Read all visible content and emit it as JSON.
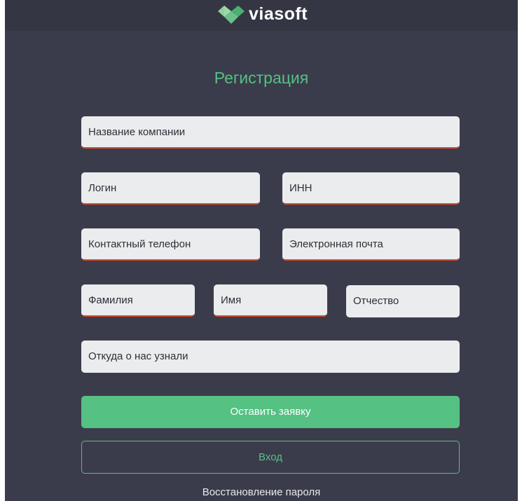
{
  "header": {
    "brand_name": "viasoft",
    "logo_icon": "viasoft-diamond-logo-icon",
    "colors": {
      "light_green": "#8fd19e",
      "dark_green": "#4caf70"
    }
  },
  "form": {
    "title": "Регистрация",
    "fields": {
      "company_name": "Название компании",
      "login": "Логин",
      "inn": "ИНН",
      "phone": "Контактный телефон",
      "email": "Электронная почта",
      "last_name": "Фамилия",
      "first_name": "Имя",
      "middle_name": "Отчество",
      "referral_source": "Откуда о нас узнали"
    },
    "submit_label": "Оставить заявку",
    "login_label": "Вход",
    "recover_link": "Восстановление пароля"
  },
  "colors": {
    "background": "#3b3c4b",
    "accent": "#55c183",
    "error_underline": "#d94a2c",
    "field_bg": "#ebecee"
  }
}
